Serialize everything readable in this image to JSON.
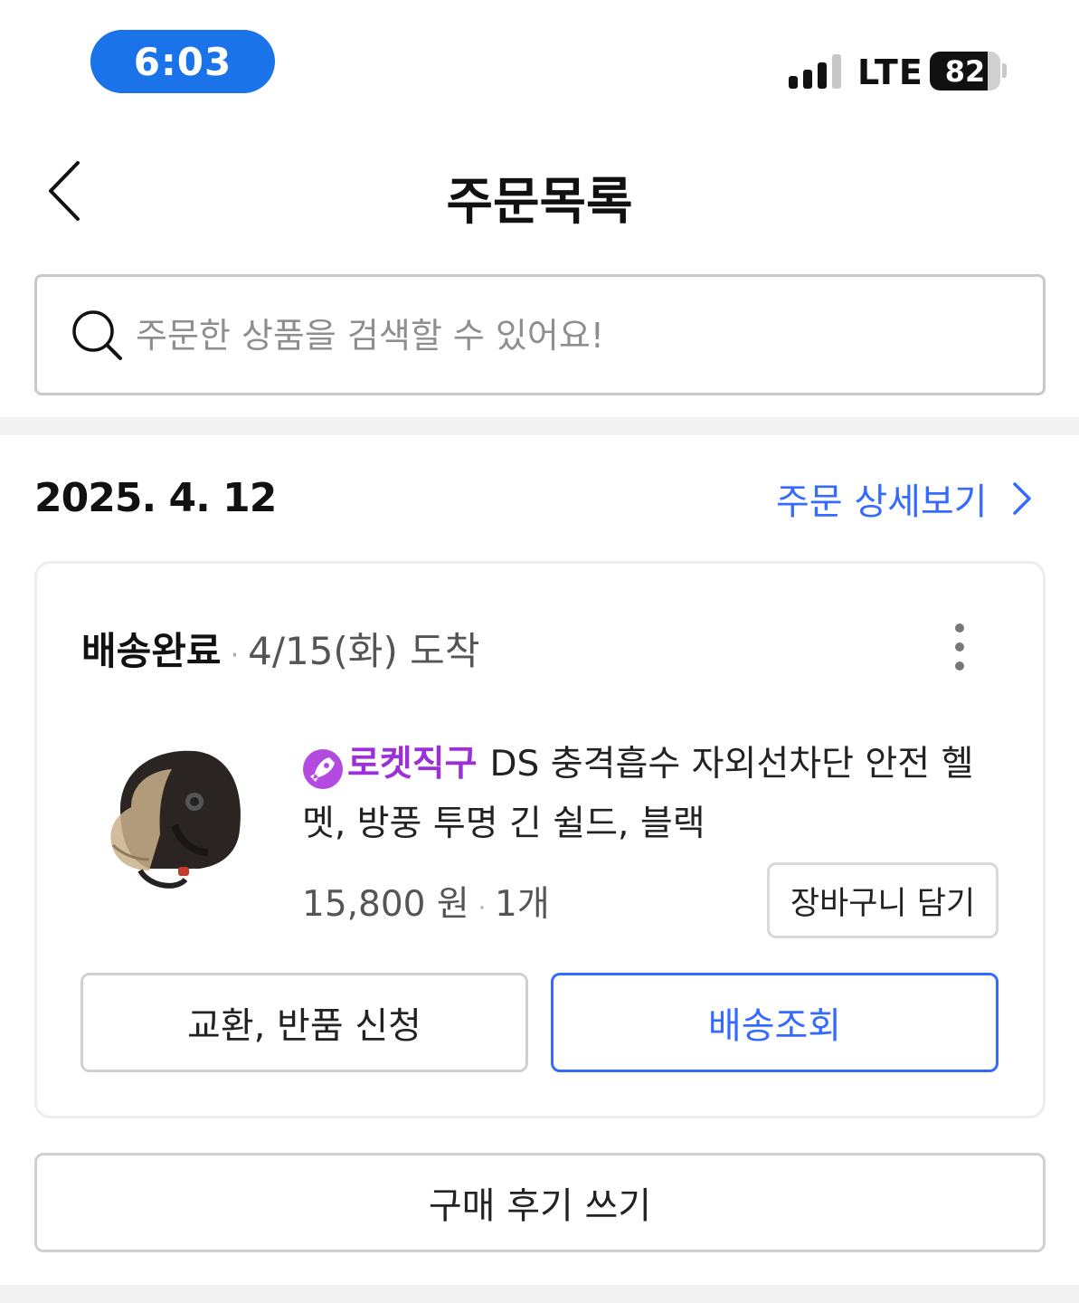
{
  "status_bar": {
    "time": "6:03",
    "network": "LTE",
    "battery": "82",
    "battery_level": 0.82
  },
  "header": {
    "title": "주문목록",
    "back_icon": "chevron-left-icon"
  },
  "search": {
    "placeholder": "주문한 상품을 검색할 수 있어요!",
    "value": "",
    "icon": "search-icon"
  },
  "order": {
    "date": "2025. 4. 12",
    "detail_link": "주문 상세보기",
    "status": "배송완료",
    "separator": "·",
    "arrival": "4/15(화) 도착",
    "product": {
      "badge": "로켓직구",
      "name": "DS 충격흡수 자외선차단 안전 헬멧, 방풍 투명 긴 쉴드, 블랙",
      "price": "15,800 원",
      "quantity": "1개"
    },
    "cart_button": "장바구니 담기",
    "return_button": "교환, 반품 신청",
    "track_button": "배송조회"
  },
  "review_button": "구매 후기 쓰기",
  "colors": {
    "accent": "#346aff",
    "time_pill": "#1a73e8",
    "rocket_badge": "#9b30d9"
  }
}
